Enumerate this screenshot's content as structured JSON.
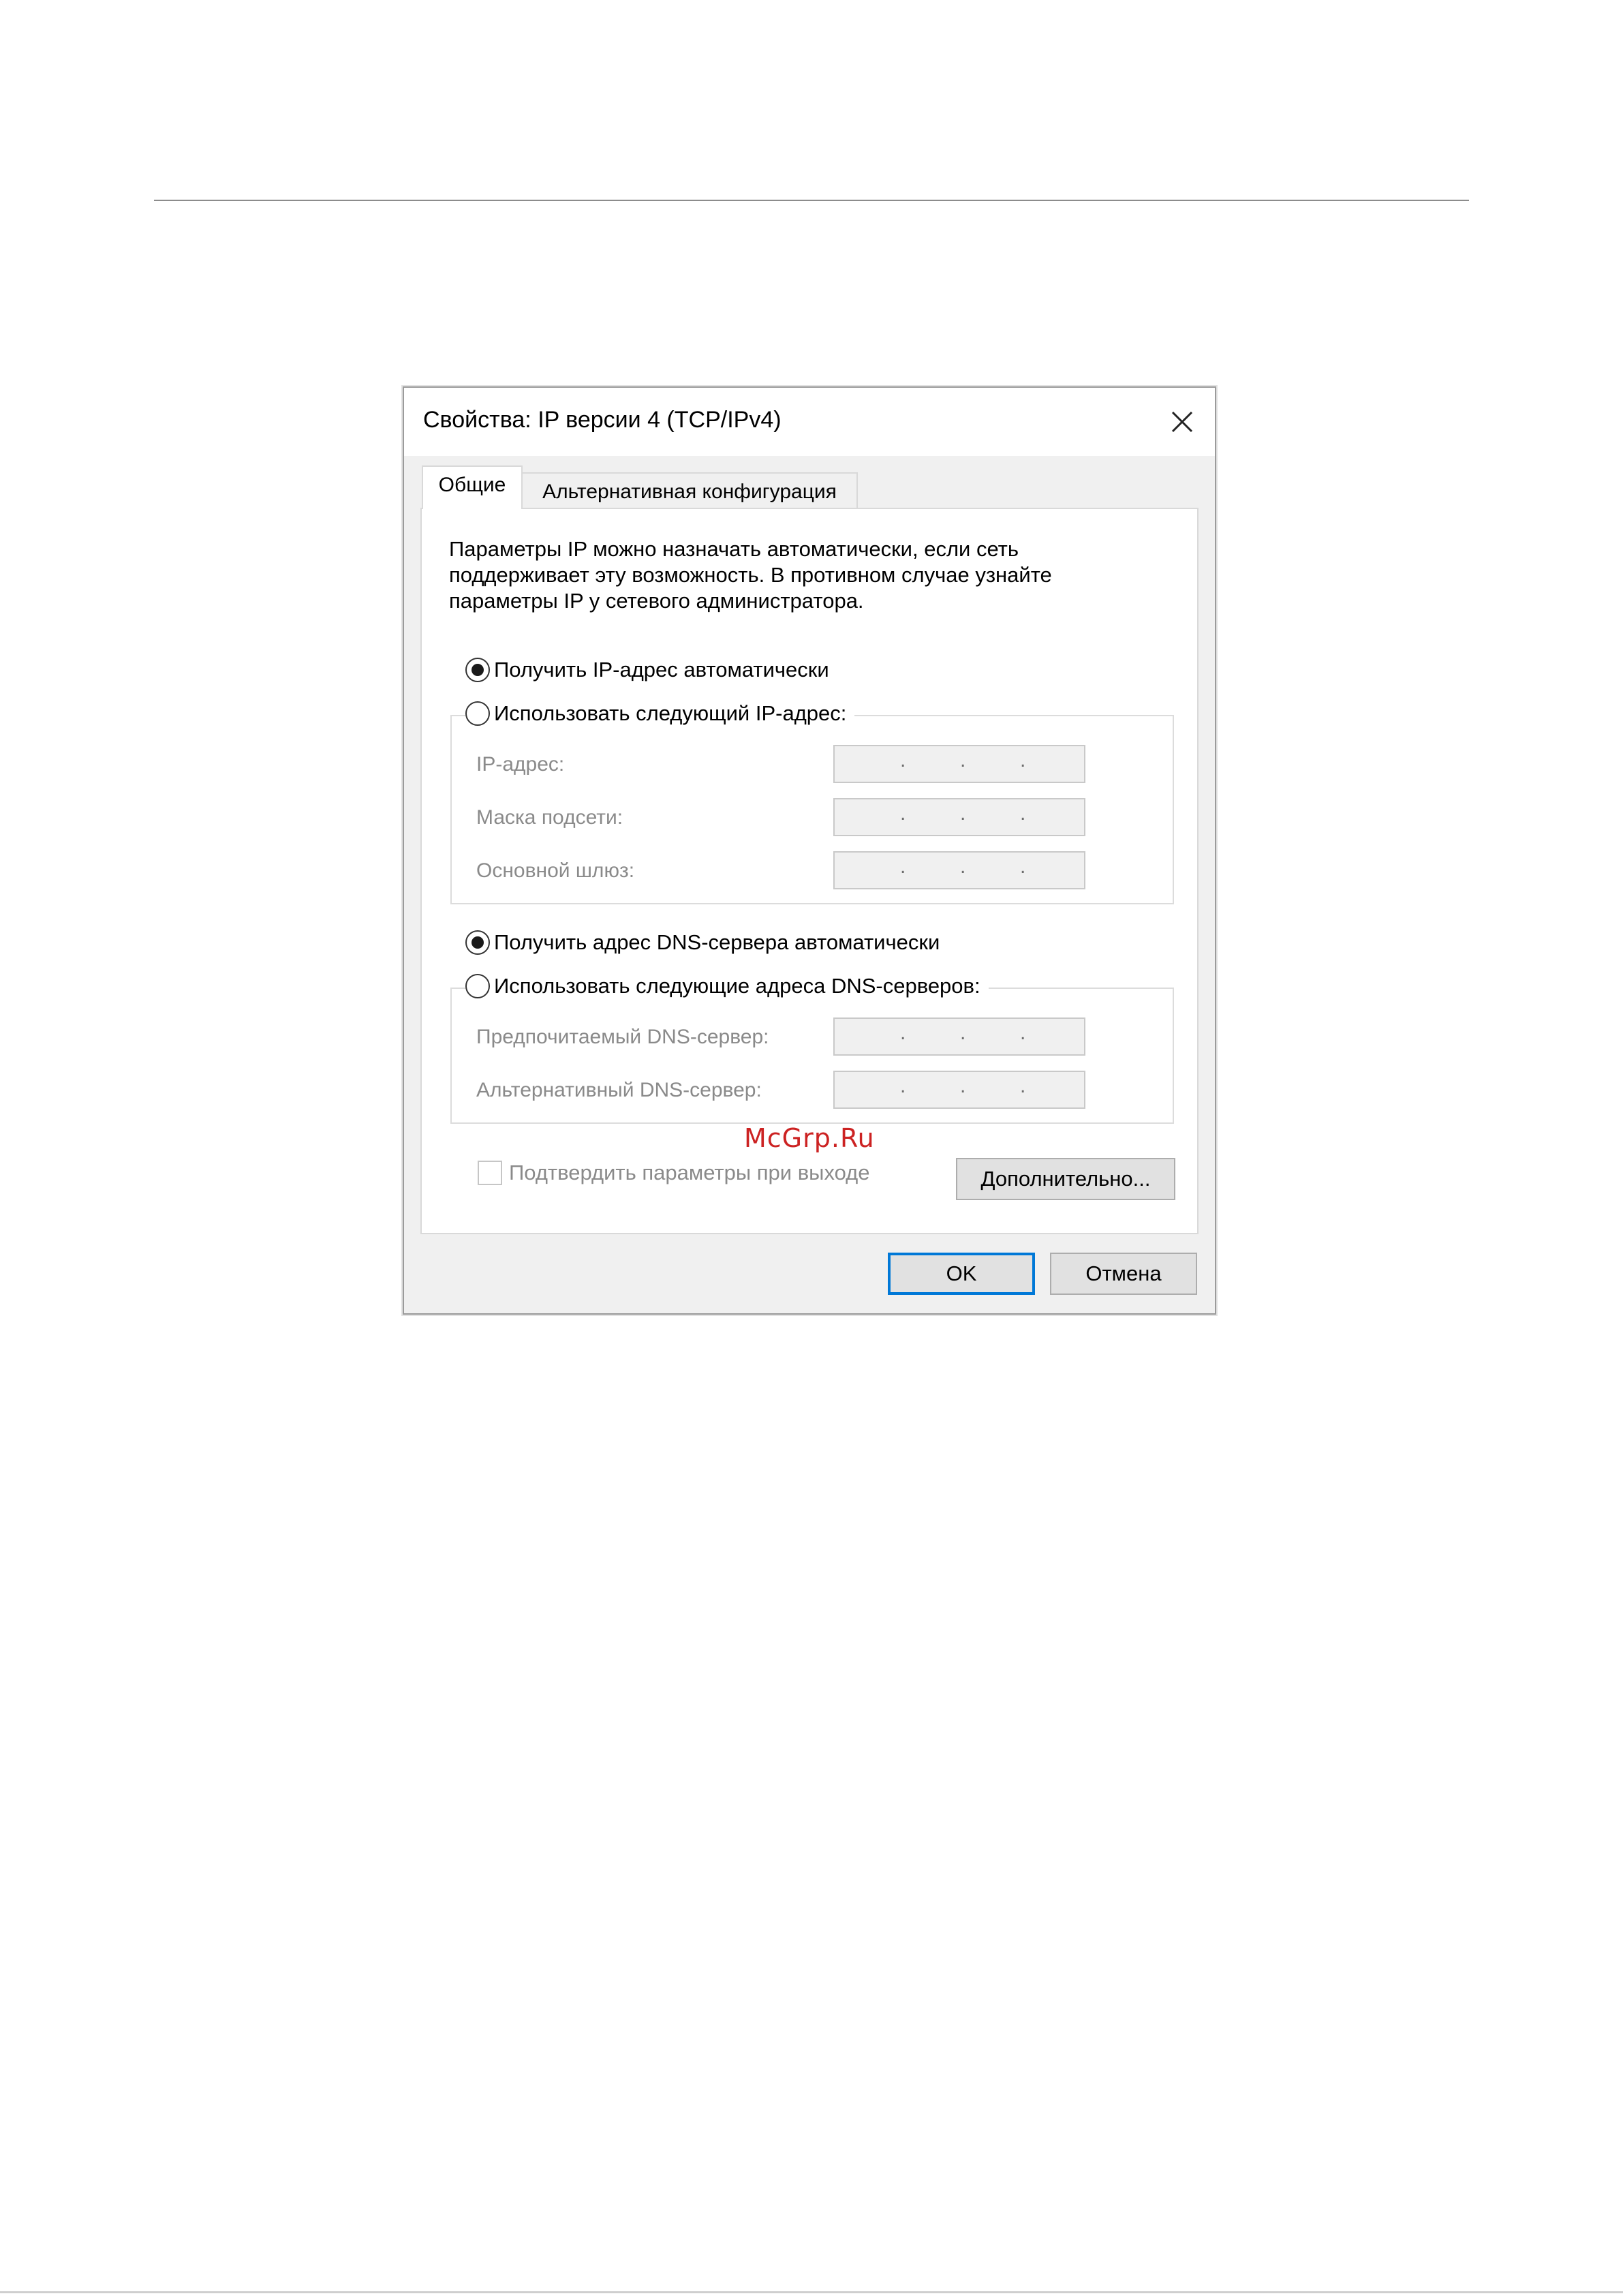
{
  "window": {
    "title": "Свойства: IP версии 4 (TCP/IPv4)",
    "close_icon": "close-icon"
  },
  "tabs": [
    {
      "label": "Общие",
      "selected": true
    },
    {
      "label": "Альтернативная конфигурация",
      "selected": false
    }
  ],
  "intro": {
    "line1": "Параметры IP можно назначать автоматически, если сеть",
    "line2": "поддерживает эту возможность. В противном случае узнайте",
    "line3": "параметры IP у сетевого администратора."
  },
  "ip_section": {
    "auto_label": "Получить IP-адрес автоматически",
    "auto_checked": true,
    "manual_label": "Использовать следующий IP-адрес:",
    "manual_checked": false,
    "fields": [
      {
        "label": "IP-адрес:",
        "value": ". . ."
      },
      {
        "label": "Маска подсети:",
        "value": ". . ."
      },
      {
        "label": "Основной шлюз:",
        "value": ". . ."
      }
    ]
  },
  "dns_section": {
    "auto_label": "Получить адрес DNS-сервера автоматически",
    "auto_checked": true,
    "manual_label": "Использовать следующие адреса DNS-серверов:",
    "manual_checked": false,
    "fields": [
      {
        "label": "Предпочитаемый DNS-сервер:",
        "value": ". . ."
      },
      {
        "label": "Альтернативный DNS-сервер:",
        "value": ". . ."
      }
    ]
  },
  "validate_checkbox": {
    "label": "Подтвердить параметры при выходе",
    "checked": false
  },
  "buttons": {
    "advanced": "Дополнительно...",
    "ok": "OK",
    "cancel": "Отмена"
  },
  "watermark": "McGrp.Ru"
}
